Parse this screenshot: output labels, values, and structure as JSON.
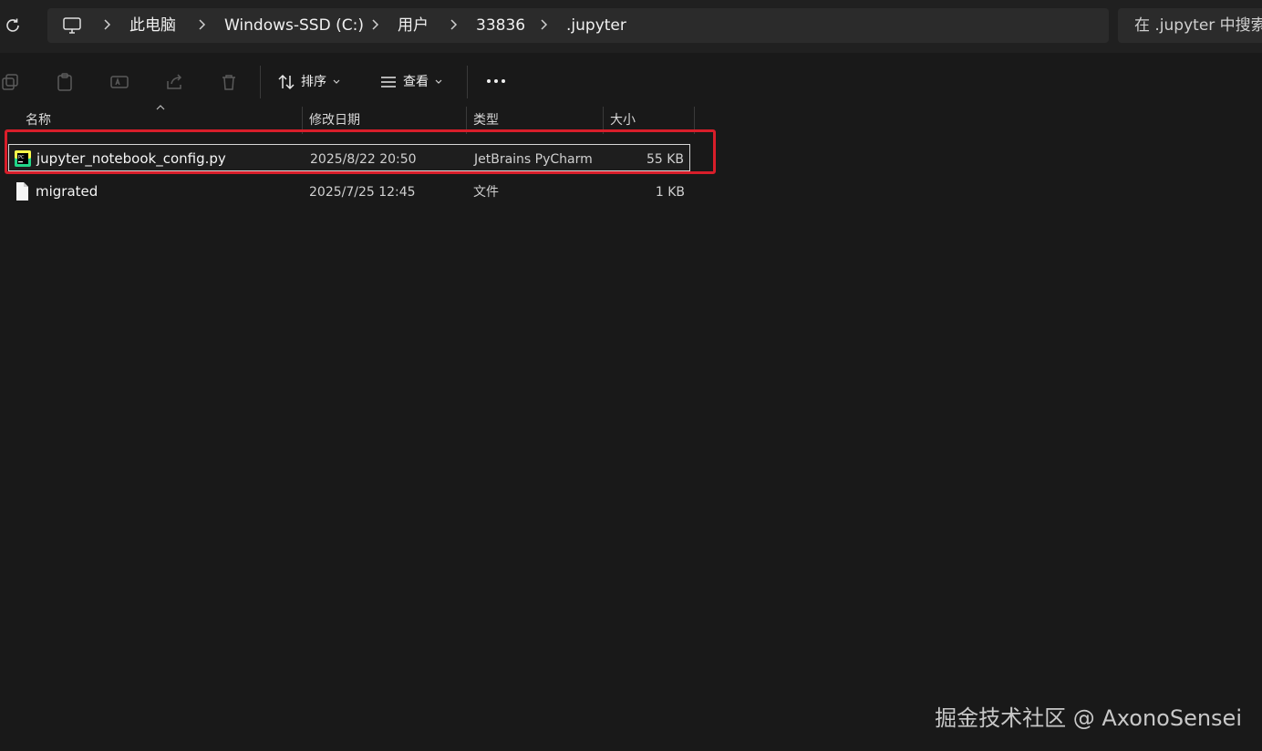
{
  "address_bar": {
    "breadcrumbs": [
      "此电脑",
      "Windows-SSD (C:)",
      "用户",
      "33836",
      ".jupyter"
    ],
    "search_placeholder": "在 .jupyter 中搜索"
  },
  "toolbar": {
    "sort_label": "排序",
    "view_label": "查看"
  },
  "columns": {
    "name": "名称",
    "date": "修改日期",
    "type": "类型",
    "size": "大小"
  },
  "files": [
    {
      "name": "jupyter_notebook_config.py",
      "date": "2025/8/22 20:50",
      "type": "JetBrains PyCharm",
      "size": "55 KB",
      "icon": "pycharm-file-icon"
    },
    {
      "name": "migrated",
      "date": "2025/7/25 12:45",
      "type": "文件",
      "size": "1 KB",
      "icon": "blank-file-icon"
    }
  ],
  "watermark": "掘金技术社区 @ AxonoSensei",
  "colors": {
    "highlight": "#d81e2a",
    "background": "#191919"
  }
}
